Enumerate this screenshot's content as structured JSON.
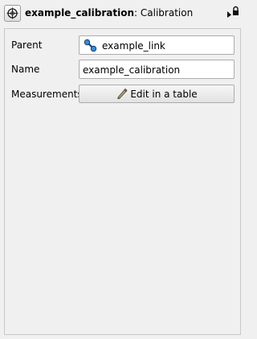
{
  "header": {
    "type_icon": "target-crosshair-icon",
    "object_name": "example_calibration",
    "separator": ":",
    "object_type": "Calibration",
    "controls": [
      "pointer-icon",
      "lock-icon"
    ]
  },
  "properties": {
    "parent": {
      "label": "Parent",
      "value": "example_link",
      "icon": "link-node-icon"
    },
    "name": {
      "label": "Name",
      "value": "example_calibration"
    },
    "measurements": {
      "label": "Measurements",
      "button_label": "Edit in a table",
      "button_icon": "pencil-icon"
    }
  },
  "colors": {
    "link_icon": "#1a7fd1",
    "background": "#f0f0f0"
  }
}
